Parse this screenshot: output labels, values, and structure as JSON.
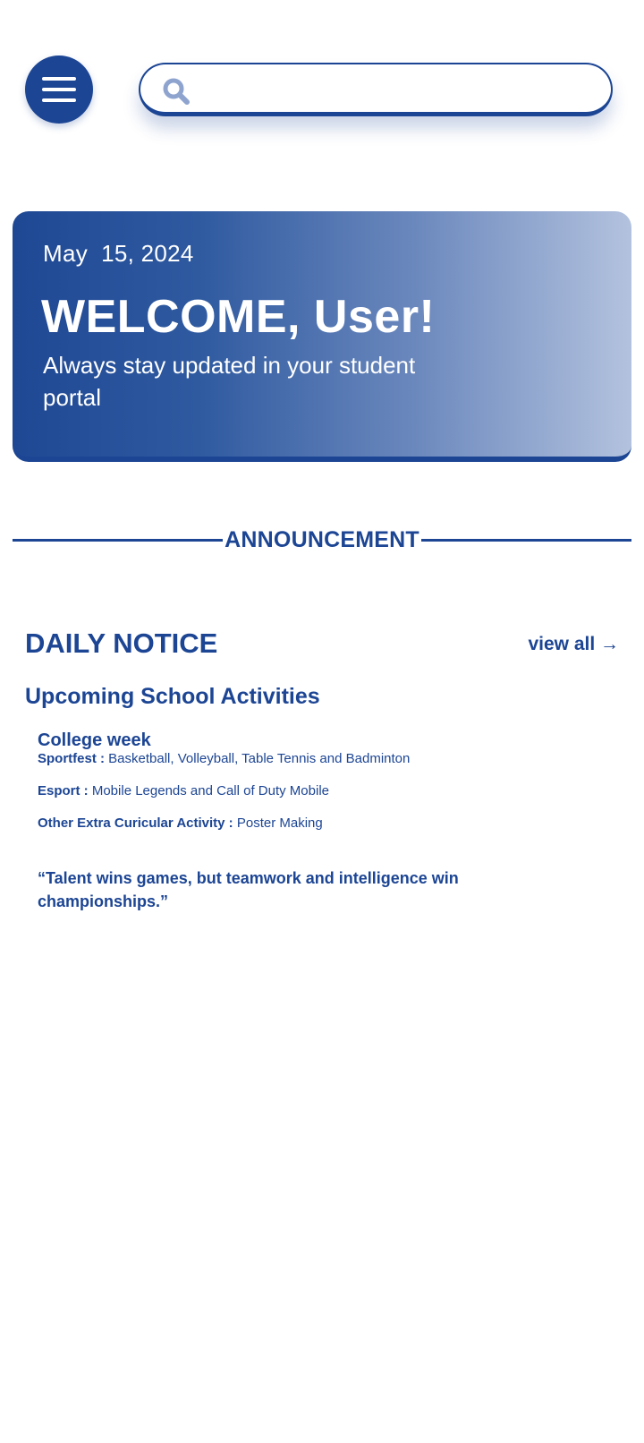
{
  "header": {
    "menu_icon": "hamburger-menu-icon",
    "search": {
      "icon": "search-icon",
      "placeholder": "",
      "value": ""
    }
  },
  "hero": {
    "date": "May  15, 2024",
    "title": "WELCOME, User!",
    "subtitle": "Always stay updated in your student portal"
  },
  "announcement": {
    "label": "ANNOUNCEMENT"
  },
  "daily_notice": {
    "title": "DAILY NOTICE",
    "view_all": "view all →",
    "section_title": "Upcoming School Activities",
    "event": "College week",
    "activities": [
      {
        "label": "Sportfest :",
        "value": "Basketball, Volleyball, Table Tennis and Badminton"
      },
      {
        "label": "Esport :",
        "value": "Mobile Legends and Call of Duty Mobile"
      },
      {
        "label": "Other Extra Curicular Activity :",
        "value": "Poster Making"
      }
    ],
    "quote": "“Talent wins games, but teamwork and intelligence win championships.”"
  },
  "colors": {
    "primary": "#1c4594",
    "background": "#ffffff",
    "hero_gradient_start": "#1f4894",
    "hero_gradient_end": "#b3c2de"
  }
}
